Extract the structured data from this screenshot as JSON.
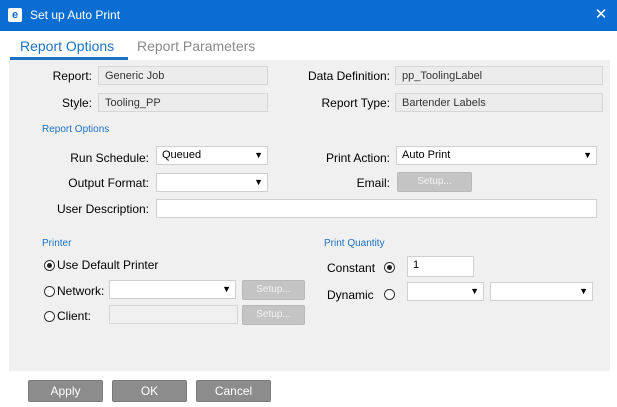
{
  "window": {
    "title": "Set up Auto Print",
    "app_icon_letter": "e",
    "close_glyph": "✕"
  },
  "tabs": [
    {
      "label": "Report Options",
      "active": true
    },
    {
      "label": "Report Parameters",
      "active": false
    }
  ],
  "report": {
    "report_label": "Report:",
    "report_value": "Generic Job",
    "style_label": "Style:",
    "style_value": "Tooling_PP",
    "data_definition_label": "Data Definition:",
    "data_definition_value": "pp_ToolingLabel",
    "report_type_label": "Report Type:",
    "report_type_value": "Bartender Labels"
  },
  "report_options": {
    "section_title": "Report Options",
    "run_schedule_label": "Run Schedule:",
    "run_schedule_value": "Queued",
    "print_action_label": "Print Action:",
    "print_action_value": "Auto Print",
    "output_format_label": "Output Format:",
    "output_format_value": "",
    "email_label": "Email:",
    "email_setup_label": "Setup...",
    "user_description_label": "User Description:",
    "user_description_value": ""
  },
  "printer": {
    "section_title": "Printer",
    "use_default_label": "Use Default Printer",
    "use_default_selected": true,
    "network_label": "Network:",
    "network_setup_label": "Setup...",
    "client_label": "Client:",
    "client_setup_label": "Setup..."
  },
  "print_quantity": {
    "section_title": "Print Quantity",
    "constant_label": "Constant",
    "constant_selected": true,
    "constant_value": "1",
    "dynamic_label": "Dynamic",
    "dynamic_selected": false
  },
  "footer": {
    "apply_label": "Apply",
    "ok_label": "OK",
    "cancel_label": "Cancel"
  },
  "colors": {
    "title_bar": "#0a6dd1",
    "tab_active": "#1c72c4",
    "panel_bg": "#f0f0f0",
    "footer_button": "#8c8c8c"
  }
}
